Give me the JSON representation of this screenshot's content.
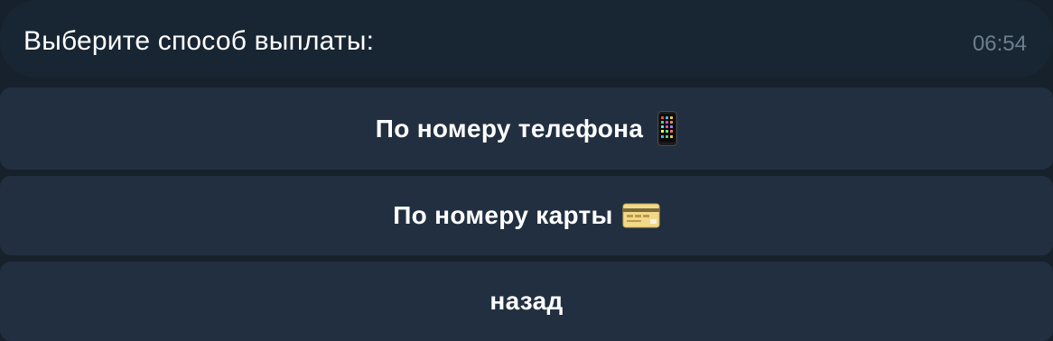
{
  "message": {
    "text": "Выберите способ выплаты:",
    "time": "06:54"
  },
  "keyboard": {
    "buttons": [
      {
        "label": "По номеру телефона",
        "icon": "mobile-phone-icon"
      },
      {
        "label": "По номеру карты",
        "icon": "credit-card-icon"
      },
      {
        "label": "назад"
      }
    ]
  },
  "colors": {
    "background": "#17212b",
    "bubble": "#182533",
    "button": "#212f40",
    "time_text": "#6d7f8f"
  }
}
